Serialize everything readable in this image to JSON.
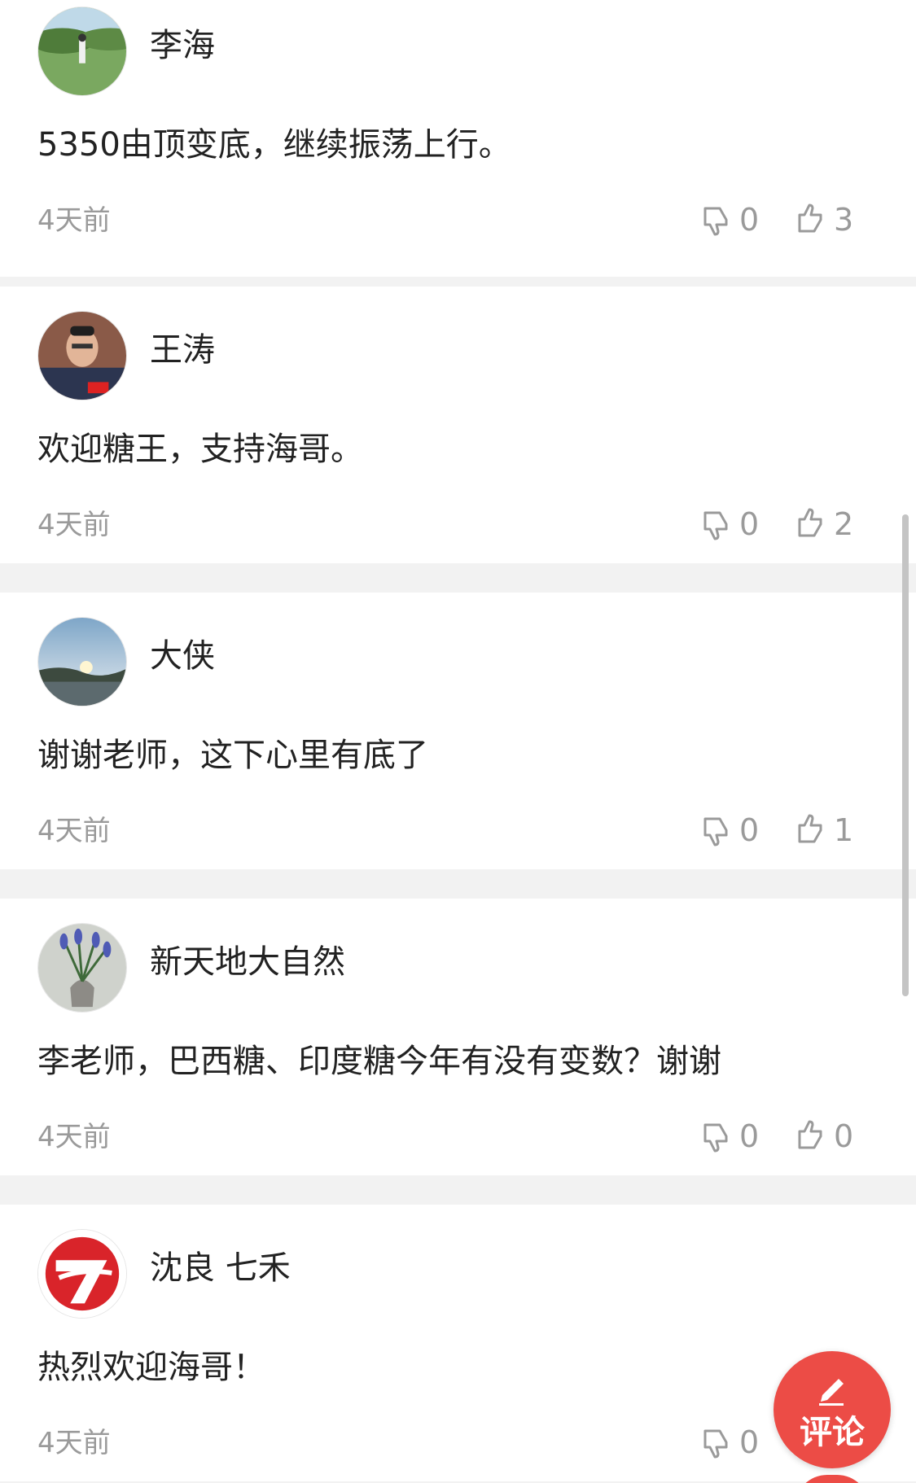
{
  "comments": [
    {
      "user": "李海",
      "text": "5350由顶变底，继续振荡上行。",
      "time": "4天前",
      "dislikes": "0",
      "likes": "3"
    },
    {
      "user": "王涛",
      "text": "欢迎糖王，支持海哥。",
      "time": "4天前",
      "dislikes": "0",
      "likes": "2"
    },
    {
      "user": "大侠",
      "text": "谢谢老师，这下心里有底了",
      "time": "4天前",
      "dislikes": "0",
      "likes": "1"
    },
    {
      "user": "新天地大自然",
      "text": "李老师，巴西糖、印度糖今年有没有变数？谢谢",
      "time": "4天前",
      "dislikes": "0",
      "likes": "0"
    },
    {
      "user": "沈良 七禾",
      "text": "热烈欢迎海哥！",
      "time": "4天前",
      "dislikes": "0",
      "likes": ""
    }
  ],
  "fab": {
    "label": "评论"
  },
  "icons": {
    "dislike": "thumbs-down-icon",
    "like": "thumbs-up-icon",
    "fab": "pencil-icon"
  },
  "colors": {
    "fab": "#ec4c46",
    "muted": "#9a9a9a",
    "text": "#222222"
  }
}
